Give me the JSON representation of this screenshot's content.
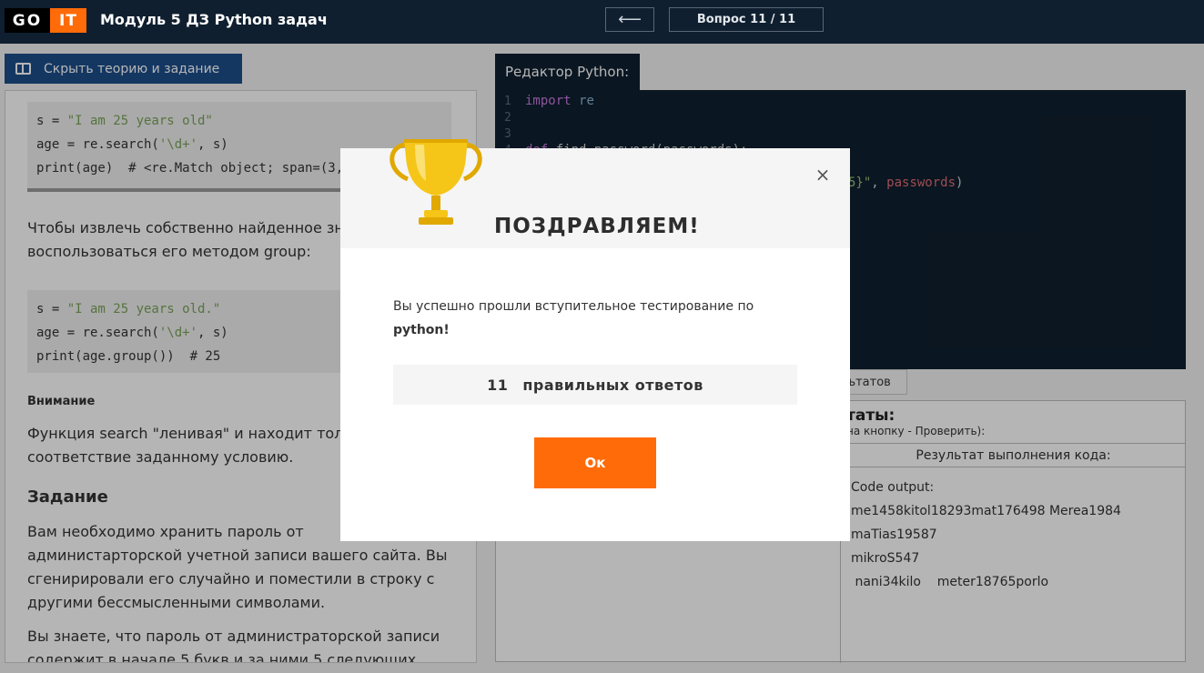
{
  "header": {
    "logo_go": "GO",
    "logo_it": "IT",
    "title": "Модуль 5 ДЗ Python задач",
    "prev_arrow": "⟵",
    "question_counter": "Вопрос 11 / 11"
  },
  "left": {
    "hide_button": "Скрыть теорию и задание",
    "code1": {
      "line1_pre": "s = ",
      "line1_str": "\"I am 25 years old\"",
      "line2_pre": "age = re.search(",
      "line2_str": "'\\d+'",
      "line2_post": ", s)",
      "line3": "print(age)  # <re.Match object; span=(3, 5), match='25'>"
    },
    "para1": "Чтобы извлечь собственно найденное значение, можно воспользоваться его методом group:",
    "code2": {
      "line1_pre": "s = ",
      "line1_str": "\"I am 25 years old.\"",
      "line2_pre": "age = re.search(",
      "line2_str": "'\\d+'",
      "line2_post": ", s)",
      "line3": "print(age.group())  # 25"
    },
    "attention": "Внимание",
    "para2": "Функция search \"ленивая\" и находит только первое соответствие заданному условию.",
    "task_heading": "Задание",
    "para3": "Вам необходимо хранить пароль от администарторской учетной записи вашего сайта. Вы сгенирировали его случайно и поместили в строку с другими бессмысленными символами.",
    "para4": "Вы знаете, что пароль от администраторской записи содержит в начале 5 букв и за ними 5 следующих"
  },
  "editor": {
    "tab_label": "Редактор Python:",
    "line_numbers": [
      "1",
      "2",
      "3",
      "4",
      "5"
    ],
    "line1_kw": "import",
    "line1_id": "re",
    "line4_kw": "def",
    "line4_rest": " find_password(passwords):",
    "line5_str": "5}\"",
    "line5_sep": ", ",
    "line5_arg": "passwords",
    "line5_end": ")"
  },
  "results": {
    "tab_label": "льтатов",
    "title": "таты:",
    "hint": "на кнопку - Проверить):",
    "column_header": "Результат выполнения кода:",
    "output": [
      "Code output:",
      "me1458kitol18293mat176498 Merea1984",
      "maTias19587",
      "mikroS547",
      " nani34kilo    meter18765porlo"
    ]
  },
  "modal": {
    "title": "ПОЗДРАВЛЯЕМ!",
    "close_glyph": "×",
    "message": "Вы успешно прошли вступительное тестирование по",
    "message_bold": "python!",
    "score_number": "11",
    "score_label": "правильных ответов",
    "ok_label": "Ок"
  },
  "colors": {
    "header_bg": "#0f1f2f",
    "accent_orange": "#ff6b08",
    "hide_button_bg": "#1d4e8a",
    "trophy_gold": "#f5c518"
  }
}
